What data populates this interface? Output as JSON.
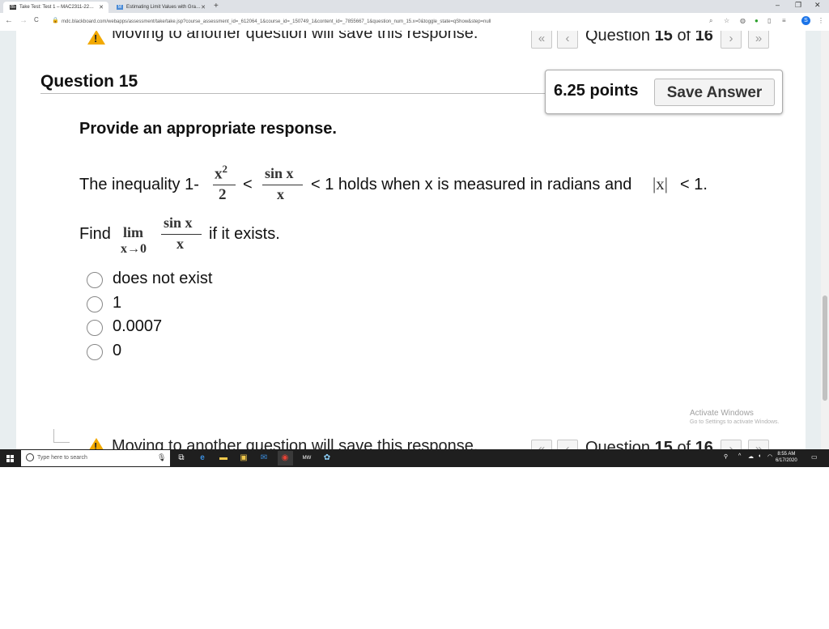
{
  "browser": {
    "tabs": [
      {
        "label": "Take Test: Test 1 – MAC2311-22…",
        "favicon": "blackboard-icon"
      },
      {
        "label": "Estimating Limit Values with Gra…",
        "favicon": "mathway-icon"
      }
    ],
    "new_tab": "+",
    "window_controls": {
      "minimize": "–",
      "restore": "❐",
      "close": "✕"
    },
    "url": "mdc.blackboard.com/webapps/assessment/take/take.jsp?course_assessment_id=_612064_1&course_id=_150749_1&content_id=_7855667_1&question_num_15.x=0&toggle_state=qShow&step=null",
    "nav": {
      "back": "←",
      "forward": "→",
      "reload": "C"
    },
    "profile_initial": "S"
  },
  "top_bar": {
    "warning": "Moving to another question will save this response.",
    "question_prefix": "Question",
    "question_num": "15",
    "question_of": "of",
    "question_total": "16",
    "first": "«",
    "prev": "‹",
    "next": "›",
    "last": "»"
  },
  "question": {
    "title": "Question 15",
    "points": "6.25 points",
    "save_label": "Save Answer",
    "prompt": "Provide an appropriate response.",
    "ineq_start": "The inequality 1-",
    "x2": "x",
    "x2_exp": "2",
    "two": "2",
    "lt": "<",
    "sinx": "sin x",
    "x": "x",
    "ineq_end_a": "< 1 holds when x is measured in radians and",
    "absx": "|x|",
    "ineq_end_b": "< 1.",
    "find": "Find",
    "lim": "lim",
    "lim_sub": "x→0",
    "find_end": "if it exists.",
    "options": [
      "does not exist",
      "1",
      "0.0007",
      "0"
    ]
  },
  "watermark": {
    "line1": "Activate Windows",
    "line2": "Go to Settings to activate Windows."
  },
  "taskbar": {
    "search_placeholder": "Type here to search",
    "time": "8:55 AM",
    "date": "6/17/2020"
  },
  "colors": {
    "warning": "#f2a900",
    "accent": "#1a73e8",
    "taskbar": "#1f1f1f"
  }
}
